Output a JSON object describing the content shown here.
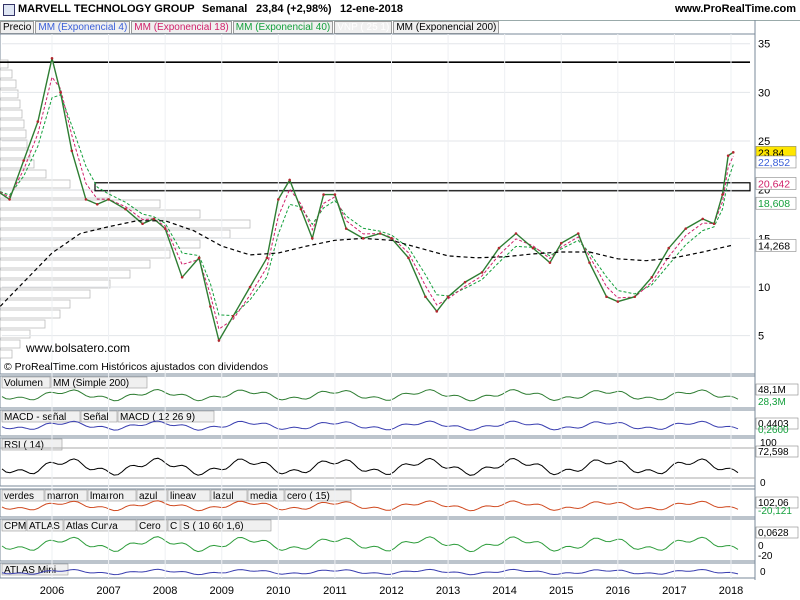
{
  "header": {
    "title": "MARVELL TECHNOLOGY GROUP",
    "period": "Semanal",
    "quote": "23,84 (+2,98%)",
    "date": "12-ene-2018",
    "site": "www.ProRealTime.com"
  },
  "main_legend": [
    {
      "label": "Precio",
      "color": "#000000"
    },
    {
      "label": "MM (Exponencial 4)",
      "color": "#3a5fd9"
    },
    {
      "label": "MM (Exponencial 18)",
      "color": "#d0206a"
    },
    {
      "label": "MM (Exponencial 40)",
      "color": "#14a03c"
    },
    {
      "label": "VNP ( 25 1)",
      "color": "#ffffff"
    },
    {
      "label": "MM (Exponencial 200)",
      "color": "#000000"
    }
  ],
  "watermark": "www.bolsatero.com",
  "credit": "© ProRealTime.com  Históricos ajustados con dividendos",
  "panels": {
    "volume": {
      "legend": [
        "Volumen",
        "MM (Simple 200)"
      ],
      "value": "48,1M",
      "value2": "28,3M"
    },
    "macd": {
      "legend": [
        "MACD - señal",
        "Señal",
        "MACD ( 12 26 9)"
      ],
      "value": "0,4403",
      "value2": "0,2600"
    },
    "rsi": {
      "legend": [
        "RSI ( 14)"
      ],
      "value": "72,598",
      "tick_top": "100",
      "tick_bottom": "0"
    },
    "osc": {
      "legend": [
        "verdes",
        "marron",
        "lmarron",
        "azul",
        "lineav",
        "lazul",
        "media",
        "cero ( 15)"
      ],
      "value": "102,06",
      "value2": "-20,121"
    },
    "cpm": {
      "legend": [
        "CPM",
        "ATLAS",
        "Atlas Curva",
        "Cero",
        "C",
        "S ( 10 60 1,6)"
      ],
      "value": "0,0628",
      "tick1": "0",
      "tick2": "-20"
    },
    "atlas": {
      "legend": [
        "ATLAS Mini"
      ],
      "tick": "0"
    }
  },
  "chart_data": {
    "type": "line",
    "title": "MARVELL TECHNOLOGY GROUP",
    "x_ticks": [
      "2006",
      "2007",
      "2008",
      "2009",
      "2010",
      "2011",
      "2012",
      "2013",
      "2014",
      "2015",
      "2016",
      "2017",
      "2018"
    ],
    "y_ticks": [
      5,
      10,
      15,
      20,
      25,
      30,
      35
    ],
    "ylim": [
      2.5,
      36
    ],
    "price_labels": [
      "23,84",
      "22,852",
      "20,642",
      "18,608",
      "14,268"
    ],
    "resistance_levels": [
      33.1,
      20.3
    ],
    "series": [
      {
        "name": "Precio",
        "color": "#000000",
        "points": [
          [
            2005.0,
            20
          ],
          [
            2005.25,
            19
          ],
          [
            2005.5,
            23
          ],
          [
            2005.75,
            27
          ],
          [
            2006.0,
            33.5
          ],
          [
            2006.15,
            30
          ],
          [
            2006.35,
            24
          ],
          [
            2006.6,
            19
          ],
          [
            2006.8,
            18.5
          ],
          [
            2007.0,
            19
          ],
          [
            2007.3,
            18
          ],
          [
            2007.6,
            16.5
          ],
          [
            2007.8,
            17
          ],
          [
            2008.0,
            16
          ],
          [
            2008.3,
            11
          ],
          [
            2008.6,
            13
          ],
          [
            2008.8,
            8
          ],
          [
            2008.95,
            4.5
          ],
          [
            2009.2,
            7
          ],
          [
            2009.5,
            10
          ],
          [
            2009.8,
            13
          ],
          [
            2010.0,
            19
          ],
          [
            2010.2,
            21
          ],
          [
            2010.4,
            18
          ],
          [
            2010.6,
            15
          ],
          [
            2010.8,
            19.5
          ],
          [
            2011.0,
            19.5
          ],
          [
            2011.2,
            16
          ],
          [
            2011.5,
            15
          ],
          [
            2011.8,
            15.5
          ],
          [
            2012.0,
            15
          ],
          [
            2012.3,
            13
          ],
          [
            2012.6,
            9
          ],
          [
            2012.8,
            7.5
          ],
          [
            2013.0,
            9
          ],
          [
            2013.3,
            10.5
          ],
          [
            2013.6,
            11.5
          ],
          [
            2013.9,
            14
          ],
          [
            2014.2,
            15.5
          ],
          [
            2014.5,
            14
          ],
          [
            2014.8,
            12.5
          ],
          [
            2015.0,
            14.5
          ],
          [
            2015.3,
            15.5
          ],
          [
            2015.5,
            12.5
          ],
          [
            2015.8,
            9
          ],
          [
            2016.0,
            8.5
          ],
          [
            2016.3,
            9
          ],
          [
            2016.6,
            11
          ],
          [
            2016.9,
            14
          ],
          [
            2017.2,
            16
          ],
          [
            2017.5,
            17
          ],
          [
            2017.7,
            16.5
          ],
          [
            2017.85,
            19.5
          ],
          [
            2017.95,
            23.5
          ],
          [
            2018.04,
            23.84
          ]
        ]
      },
      {
        "name": "MM (Exponencial 200)",
        "color": "#000000",
        "points": [
          [
            2005.0,
            7.5
          ],
          [
            2005.5,
            10.5
          ],
          [
            2006.0,
            13.5
          ],
          [
            2006.5,
            15.5
          ],
          [
            2007.0,
            16.2
          ],
          [
            2007.5,
            16.8
          ],
          [
            2008.0,
            16.8
          ],
          [
            2008.5,
            15.8
          ],
          [
            2009.0,
            14.2
          ],
          [
            2009.5,
            13.3
          ],
          [
            2010.0,
            13.5
          ],
          [
            2010.5,
            14.2
          ],
          [
            2011.0,
            14.8
          ],
          [
            2011.5,
            15.0
          ],
          [
            2012.0,
            14.8
          ],
          [
            2012.5,
            14.0
          ],
          [
            2013.0,
            13.2
          ],
          [
            2013.5,
            13.0
          ],
          [
            2014.0,
            13.1
          ],
          [
            2014.5,
            13.4
          ],
          [
            2015.0,
            13.6
          ],
          [
            2015.5,
            13.6
          ],
          [
            2016.0,
            12.9
          ],
          [
            2016.5,
            12.7
          ],
          [
            2017.0,
            13.0
          ],
          [
            2017.5,
            13.6
          ],
          [
            2018.0,
            14.27
          ]
        ]
      }
    ]
  }
}
